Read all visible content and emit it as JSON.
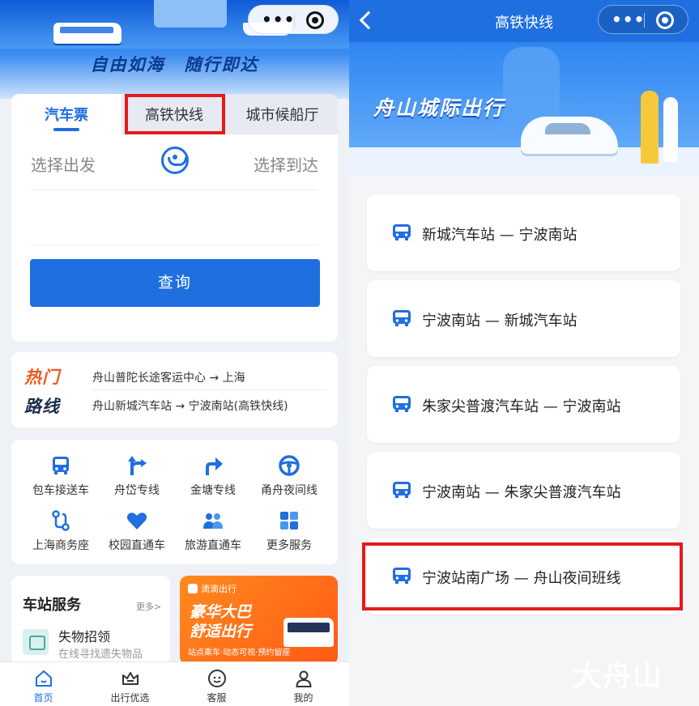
{
  "left": {
    "banner": {
      "slogan_1": "自由如海",
      "slogan_2": "随行即达"
    },
    "tabs": [
      "汽车票",
      "高铁快线",
      "城市候船厅"
    ],
    "from_label": "选择出发",
    "to_label": "选择到达",
    "query_label": "查询",
    "hot": {
      "label_1": "热门",
      "label_2": "路线",
      "routes": [
        "舟山普陀长途客运中心 → 上海",
        "舟山新城汽车站 → 宁波南站(高铁快线)"
      ]
    },
    "services": [
      {
        "label": "包车接送车",
        "icon": "bus-icon"
      },
      {
        "label": "舟岱专线",
        "icon": "fork-arrow-icon"
      },
      {
        "label": "金塘专线",
        "icon": "turn-arrow-icon"
      },
      {
        "label": "甬舟夜间线",
        "icon": "steering-wheel-icon"
      },
      {
        "label": "上海商务座",
        "icon": "route-icon"
      },
      {
        "label": "校园直通车",
        "icon": "heart-icon"
      },
      {
        "label": "旅游直通车",
        "icon": "group-icon"
      },
      {
        "label": "更多服务",
        "icon": "grid-icon"
      }
    ],
    "station": {
      "title": "车站服务",
      "more": "更多>",
      "item_title": "失物招领",
      "item_sub": "在线寻找遗失物品"
    },
    "ad": {
      "brand": "滴滴出行",
      "title_1": "豪华大巴",
      "title_2": "舒适出行",
      "tagline": "站点乘车·动态可视·预约留座"
    },
    "nav": [
      "首页",
      "出行优选",
      "客服",
      "我的"
    ]
  },
  "right": {
    "title": "高铁快线",
    "banner_title": "舟山城际出行",
    "routes": [
      "新城汽车站 — 宁波南站",
      "宁波南站 — 新城汽车站",
      "朱家尖普渡汽车站 — 宁波南站",
      "宁波南站 — 朱家尖普渡汽车站",
      "宁波站南广场 — 舟山夜间班线"
    ]
  },
  "watermark": "大舟山",
  "colors": {
    "primary": "#1f6fe0",
    "highlight": "#e31b1b",
    "hot": "#f05a1e"
  }
}
